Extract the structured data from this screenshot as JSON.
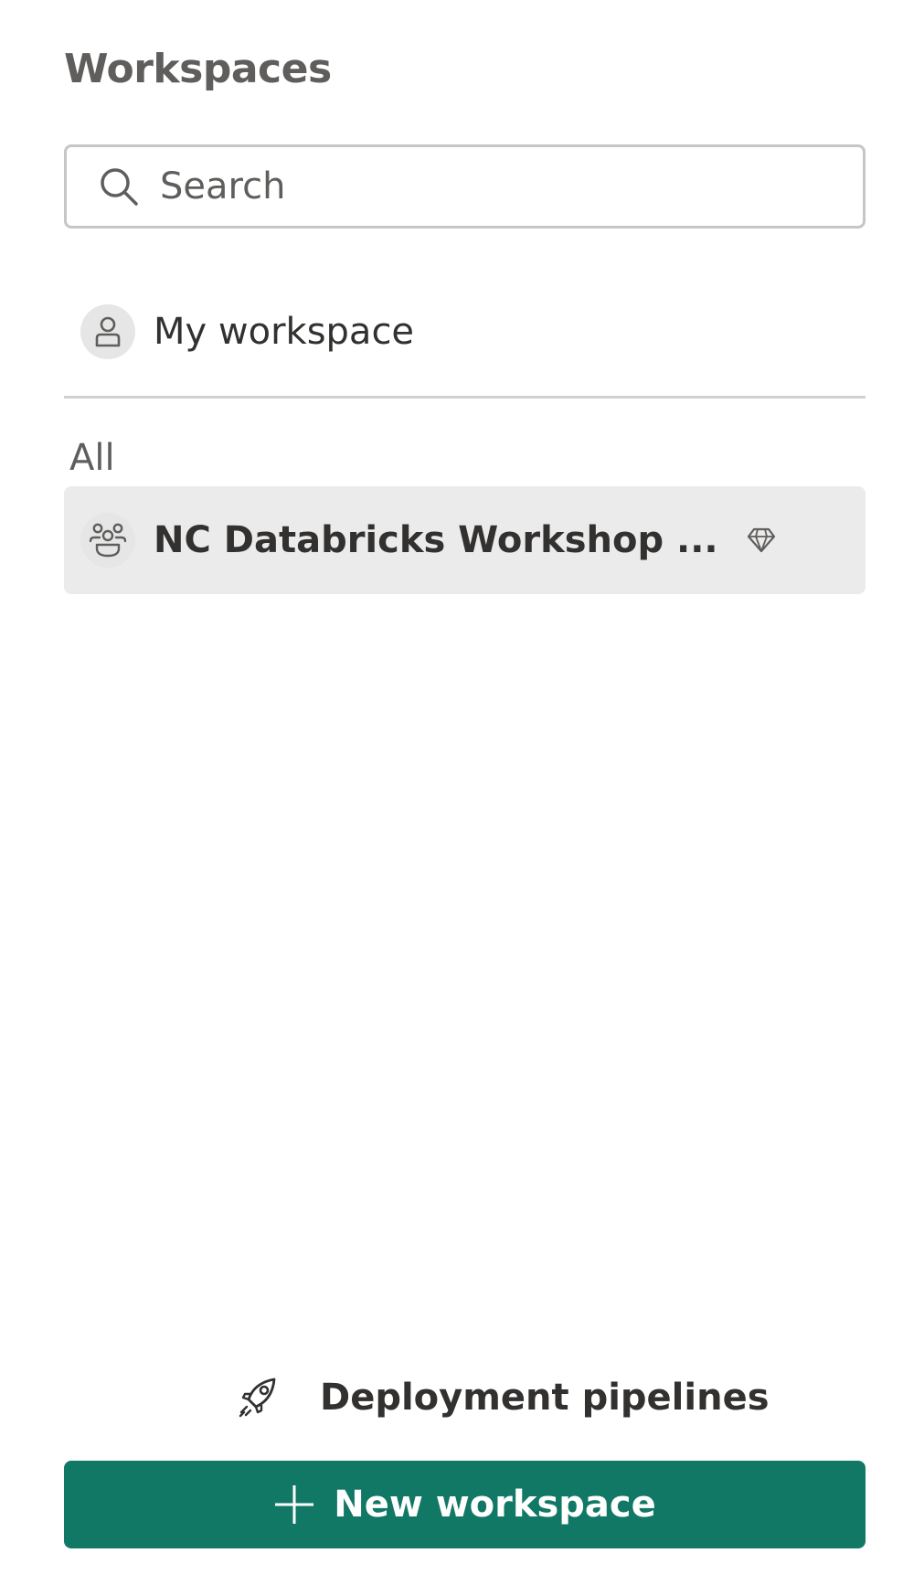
{
  "header": {
    "title": "Workspaces"
  },
  "search": {
    "placeholder": "Search",
    "icon": "search-icon"
  },
  "my_workspace": {
    "label": "My workspace",
    "icon": "person-icon"
  },
  "section": {
    "label": "All"
  },
  "workspaces": [
    {
      "label": "NC Databricks Workshop ...",
      "icon": "group-icon",
      "badge_icon": "diamond-icon",
      "selected": true
    }
  ],
  "footer": {
    "deployment_label": "Deployment pipelines",
    "deployment_icon": "rocket-icon",
    "new_workspace_label": "New workspace",
    "new_workspace_icon": "plus-icon"
  },
  "colors": {
    "accent": "#117865",
    "selected_bg": "#ebebeb",
    "border": "#c8c6c4"
  }
}
